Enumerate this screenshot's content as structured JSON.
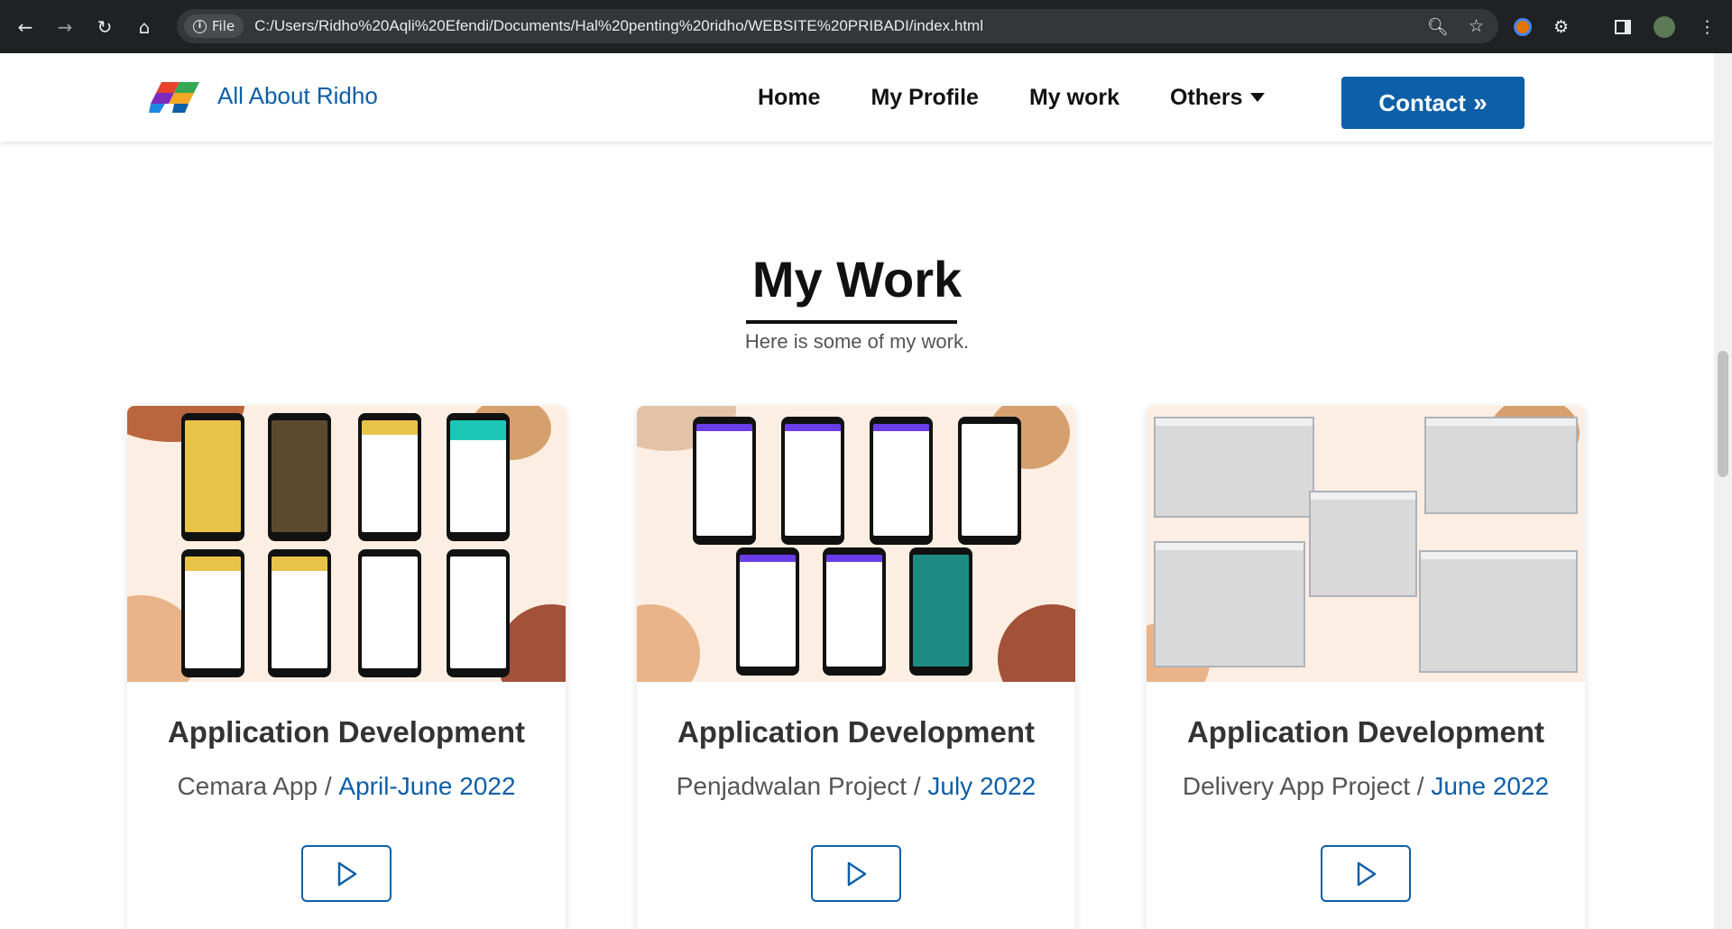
{
  "browser": {
    "chip_label": "File",
    "url": "C:/Users/Ridho%20Aqli%20Efendi/Documents/Hal%20penting%20ridho/WEBSITE%20PRIBADI/index.html"
  },
  "site": {
    "brand_name": "All About Ridho",
    "menu": [
      "Home",
      "My Profile",
      "My work",
      "Others"
    ],
    "contact_label": "Contact",
    "colors": {
      "accent": "#0d5fa8",
      "thumb_bg": "#fdeee3"
    }
  },
  "work": {
    "title": "My Work",
    "subtitle": "Here is some of my work.",
    "cards": [
      {
        "title": "Application Development",
        "project": "Cemara App",
        "separator": "/",
        "date": "April-June 2022"
      },
      {
        "title": "Application Development",
        "project": "Penjadwalan Project",
        "separator": "/",
        "date": "July 2022"
      },
      {
        "title": "Application Development",
        "project": "Delivery App Project",
        "separator": "/",
        "date": "June 2022"
      }
    ]
  }
}
